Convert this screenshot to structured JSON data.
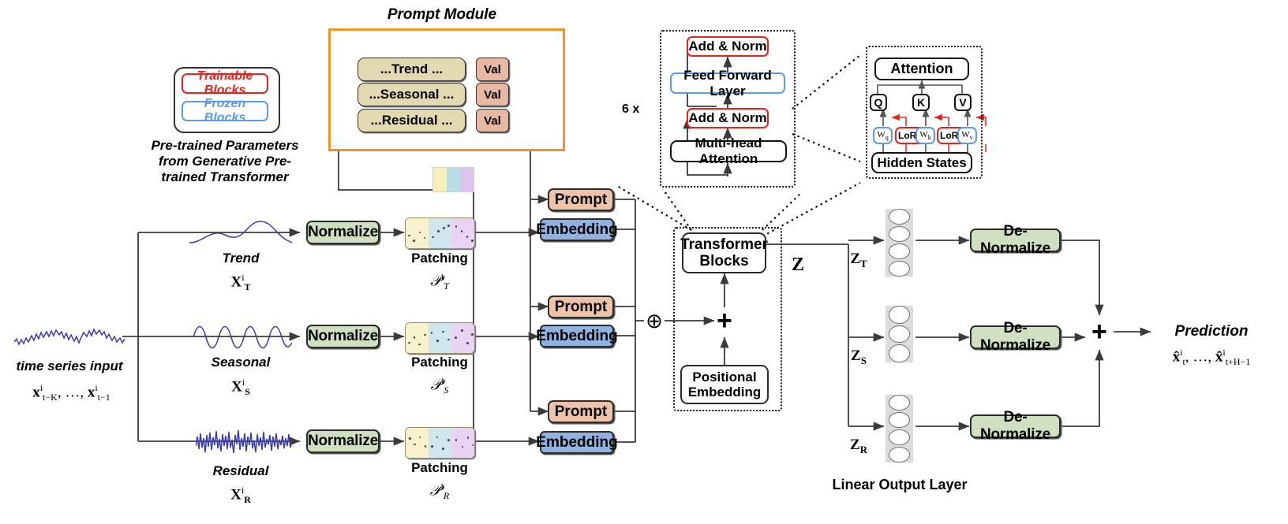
{
  "figure": {
    "title": "Prompt Module",
    "legend": {
      "trainable": "Trainable Blocks",
      "frozen": "Frozen Blocks",
      "caption_line1": "Pre-trained Parameters",
      "caption_line2": "from Generative Pre-",
      "caption_line3": "trained Transformer",
      "trainable_color": "#e8211a",
      "frozen_color": "#5a9bea"
    }
  },
  "prompt_module": {
    "panel_color": "#f0952a",
    "rows": [
      {
        "text": "...Trend ...",
        "value": "Val"
      },
      {
        "text": "...Seasonal ...",
        "value": "Val"
      },
      {
        "text": "...Residual ...",
        "value": "Val"
      }
    ]
  },
  "input": {
    "caption": "time series input",
    "math": "xt−K, …, xt−1"
  },
  "branches": [
    {
      "name": "Trend",
      "symbol": "X",
      "sub": "T",
      "sup": "i",
      "normalize": "Normalize",
      "patching": "Patching",
      "patch_symbol": "P",
      "patch_sub": "T",
      "patch_sup": "i",
      "prompt": "Prompt",
      "embedding": "Embedding"
    },
    {
      "name": "Seasonal",
      "symbol": "X",
      "sub": "S",
      "sup": "i",
      "normalize": "Normalize",
      "patching": "Patching",
      "patch_symbol": "P",
      "patch_sub": "S",
      "patch_sup": "i",
      "prompt": "Prompt",
      "embedding": "Embedding"
    },
    {
      "name": "Residual",
      "symbol": "X",
      "sub": "R",
      "sup": "i",
      "normalize": "Normalize",
      "patching": "Patching",
      "patch_symbol": "P",
      "patch_sub": "R",
      "patch_sup": "i",
      "prompt": "Prompt",
      "embedding": "Embedding"
    }
  ],
  "encoder_detail": {
    "repeat_label": "6 x",
    "blocks": [
      {
        "label": "Add & Norm",
        "style": "trainable"
      },
      {
        "label": "Feed Forward Layer",
        "style": "frozen"
      },
      {
        "label": "Add & Norm",
        "style": "trainable"
      },
      {
        "label": "Multi-head Attention",
        "style": "black"
      }
    ]
  },
  "attention_detail": {
    "title": "Attention",
    "hidden_states": "Hidden States",
    "heads": [
      {
        "name": "Q",
        "weight": "W",
        "weight_sub": "q",
        "lora": "LoRA"
      },
      {
        "name": "K",
        "weight": "W",
        "weight_sub": "k",
        "lora": "LoRA"
      },
      {
        "name": "V",
        "weight": "W",
        "weight_sub": "v",
        "lora": "LoRA"
      }
    ]
  },
  "core": {
    "transformer_blocks_line1": "Transformer",
    "transformer_blocks_line2": "Blocks",
    "positional_line1": "Positional",
    "positional_line2": "Embedding",
    "sum_symbol": "+",
    "circle_plus": "⊕",
    "z_label": "Z"
  },
  "output": {
    "z_labels": [
      {
        "symbol": "Z",
        "sub": "T"
      },
      {
        "symbol": "Z",
        "sub": "S"
      },
      {
        "symbol": "Z",
        "sub": "R"
      }
    ],
    "denormalize": "De-Normalize",
    "linear_output_layer": "Linear Output Layer",
    "neuron_counts": [
      4,
      3,
      4
    ],
    "prediction_label": "Prediction",
    "prediction_math": "x̂t, …, x̂t+H−1",
    "final_sum": "+"
  },
  "colors": {
    "patch_1": "#f7f2cd",
    "patch_2": "#cfe7ec",
    "patch_3": "#e8d4f2",
    "normalize": "#cfe0c0",
    "embedding": "#8fb2e0",
    "prompt": "#eec3a8",
    "prompt_row": "#e3d9b0"
  }
}
